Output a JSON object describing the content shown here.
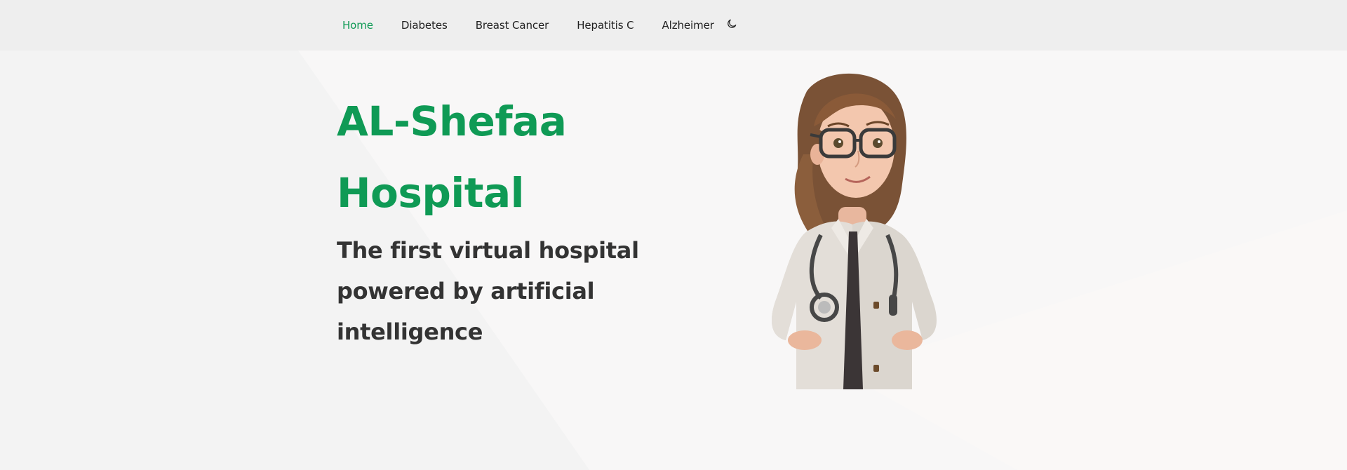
{
  "nav": {
    "items": [
      {
        "label": "Home",
        "active": true
      },
      {
        "label": "Diabetes",
        "active": false
      },
      {
        "label": "Breast Cancer",
        "active": false
      },
      {
        "label": "Hepatitis C",
        "active": false
      },
      {
        "label": "Alzheimer",
        "active": false
      }
    ],
    "theme_toggle_icon": "moon-icon"
  },
  "hero": {
    "title": "AL-Shefaa Hospital",
    "subtitle": "The first virtual hospital powered by artificial intelligence",
    "illustration": "doctor-illustration"
  },
  "colors": {
    "accent": "#0f9a55",
    "text_dark": "#333333",
    "nav_text": "#1f1f1f",
    "background": "#f6f5f5"
  }
}
